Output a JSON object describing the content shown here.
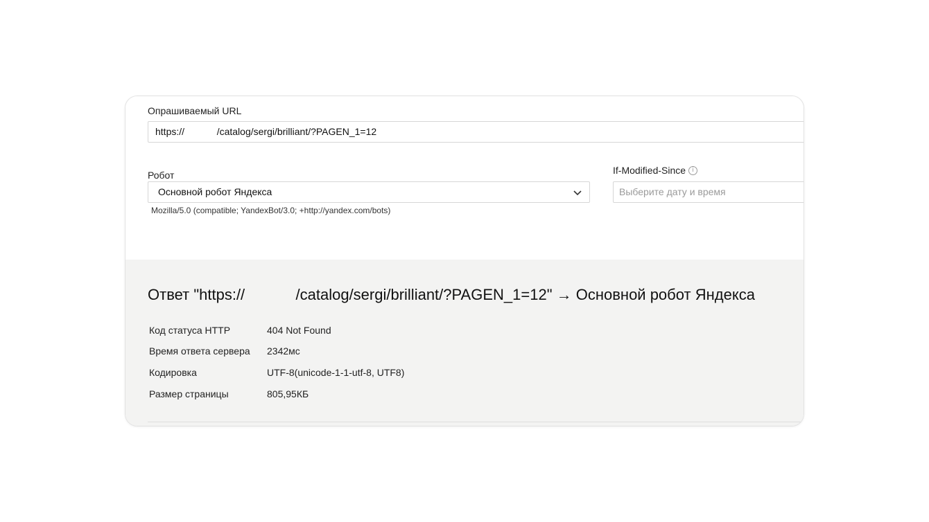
{
  "form": {
    "url_label": "Опрашиваемый URL",
    "url_value": "https://            /catalog/sergi/brilliant/?PAGEN_1=12",
    "robot_label": "Робот",
    "robot_selected": "Основной робот Яндекса",
    "user_agent": "Mozilla/5.0 (compatible; YandexBot/3.0; +http://yandex.com/bots)",
    "ims_label": "If-Modified-Since",
    "ims_placeholder": "Выберите дату и время"
  },
  "result": {
    "title": "Ответ \"https://            /catalog/sergi/brilliant/?PAGEN_1=12\" → Основной робот Яндекса",
    "rows": [
      {
        "key": "Код статуса HTTP",
        "value": "404 Not Found"
      },
      {
        "key": "Время ответа сервера",
        "value": "2342мс"
      },
      {
        "key": "Кодировка",
        "value": "UTF-8(unicode-1-1-utf-8, UTF8)"
      },
      {
        "key": "Размер страницы",
        "value": "805,95КБ"
      }
    ]
  },
  "icons": {
    "info": "info-icon",
    "chevron": "chevron-down-icon"
  }
}
